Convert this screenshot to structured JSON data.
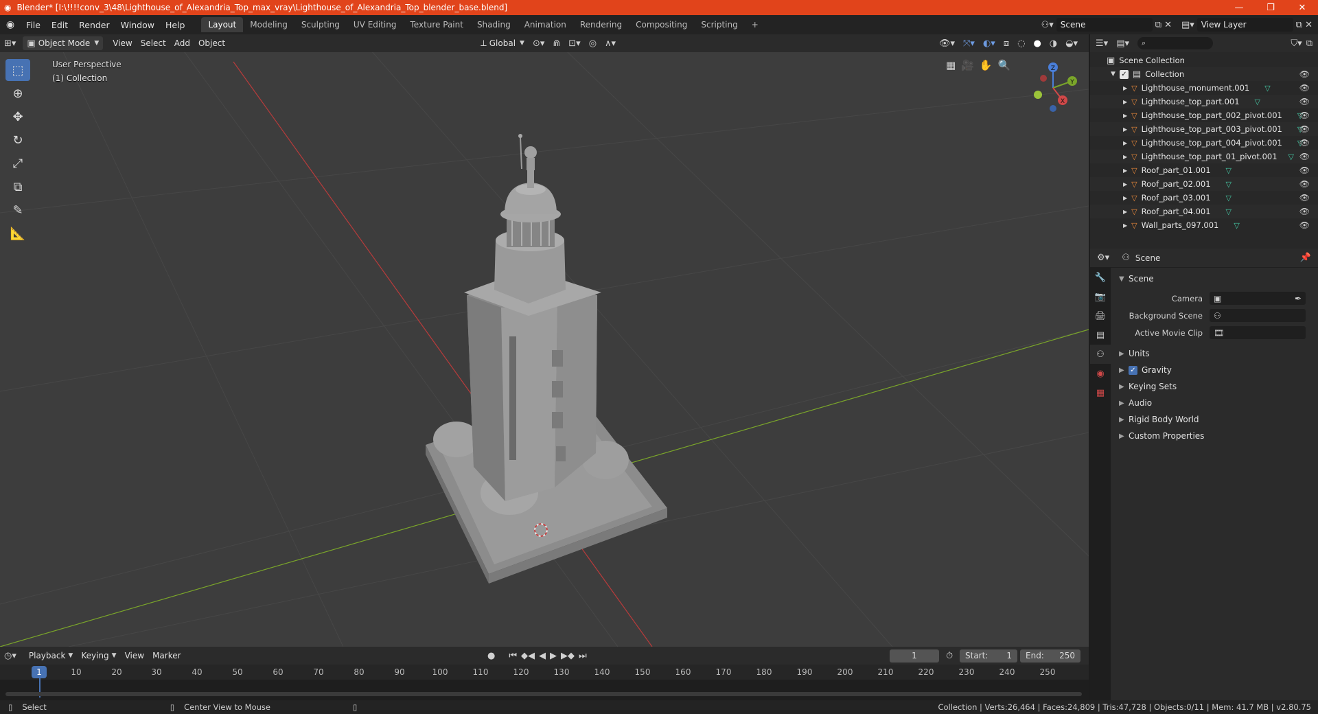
{
  "window": {
    "title": "Blender* [I:\\!!!!conv_3\\48\\Lighthouse_of_Alexandria_Top_max_vray\\Lighthouse_of_Alexandria_Top_blender_base.blend]",
    "minimize": "—",
    "maximize": "❐",
    "close": "✕"
  },
  "menu": {
    "items": [
      "File",
      "Edit",
      "Render",
      "Window",
      "Help"
    ],
    "workspaces": [
      "Layout",
      "Modeling",
      "Sculpting",
      "UV Editing",
      "Texture Paint",
      "Shading",
      "Animation",
      "Rendering",
      "Compositing",
      "Scripting"
    ],
    "active_workspace": "Layout",
    "add_tab": "+",
    "scene": "Scene",
    "view_layer": "View Layer"
  },
  "viewport": {
    "mode": "Object Mode",
    "menus": [
      "View",
      "Select",
      "Add",
      "Object"
    ],
    "orientation": "Global",
    "perspective_label": "User Perspective",
    "collection_label": "(1) Collection",
    "gizmo": {
      "x": "X",
      "y": "Y",
      "z": "Z"
    }
  },
  "timeline": {
    "menus": [
      "Playback",
      "Keying",
      "View",
      "Marker"
    ],
    "current_frame": "1",
    "start_label": "Start:",
    "start": "1",
    "end_label": "End:",
    "end": "250",
    "ticks": [
      "10",
      "20",
      "30",
      "40",
      "50",
      "60",
      "70",
      "80",
      "90",
      "100",
      "110",
      "120",
      "130",
      "140",
      "150",
      "160",
      "170",
      "180",
      "190",
      "200",
      "210",
      "220",
      "230",
      "240",
      "250"
    ],
    "frame_marker": "1"
  },
  "statusbar": {
    "select": "Select",
    "center_view": "Center View to Mouse",
    "stats": "Collection | Verts:26,464 | Faces:24,809 | Tris:47,728 | Objects:0/11 | Mem: 41.7 MB | v2.80.75"
  },
  "outliner": {
    "root": "Scene Collection",
    "collection": "Collection",
    "objects": [
      "Lighthouse_monument.001",
      "Lighthouse_top_part.001",
      "Lighthouse_top_part_002_pivot.001",
      "Lighthouse_top_part_003_pivot.001",
      "Lighthouse_top_part_004_pivot.001",
      "Lighthouse_top_part_01_pivot.001",
      "Roof_part_01.001",
      "Roof_part_02.001",
      "Roof_part_03.001",
      "Roof_part_04.001",
      "Wall_parts_097.001"
    ]
  },
  "properties": {
    "context": "Scene",
    "panel_title": "Scene",
    "camera_label": "Camera",
    "background_scene_label": "Background Scene",
    "active_movie_clip_label": "Active Movie Clip",
    "sections": [
      "Units",
      "Gravity",
      "Keying Sets",
      "Audio",
      "Rigid Body World",
      "Custom Properties"
    ],
    "gravity_checked": true
  },
  "colors": {
    "titlebar": "#e1441b",
    "accent": "#4772b3",
    "object_icon": "#e8883a",
    "mesh_icon": "#45c9a5",
    "x_axis": "#b83b3b",
    "y_axis": "#7aa52a"
  }
}
